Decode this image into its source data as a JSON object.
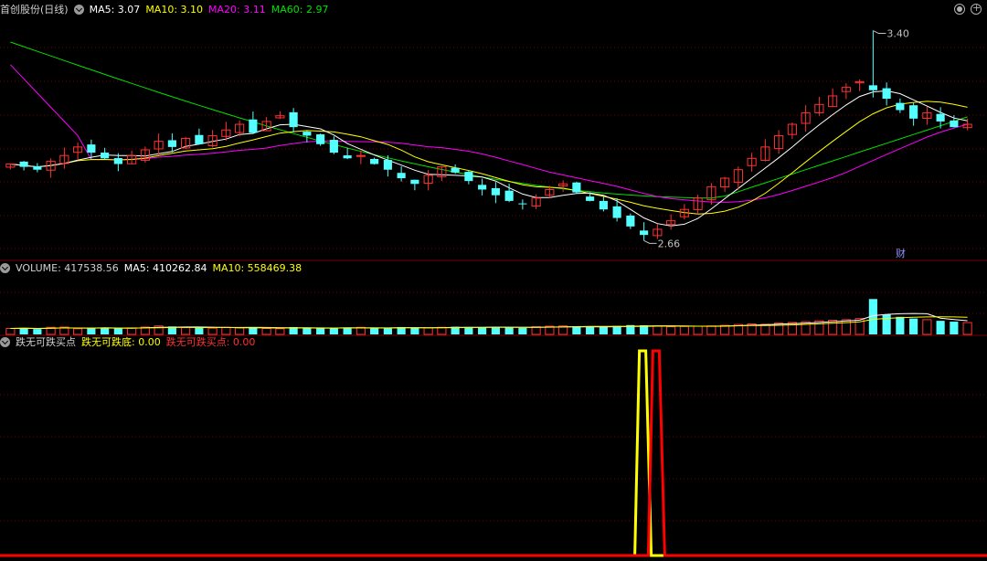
{
  "header_price": {
    "name": "首创股份(日线)",
    "ma5": "MA5: 3.07",
    "ma10": "MA10: 3.10",
    "ma20": "MA20: 3.11",
    "ma60": "MA60: 2.97"
  },
  "header_volume": {
    "name": "VOLUME: 417538.56",
    "ma5": "MA5: 410262.84",
    "ma10": "MA10: 558469.38"
  },
  "header_indicator": {
    "name": "跌无可跌买点",
    "line1": "跌无可跌底: 0.00",
    "line2": "跌无可跌买点: 0.00"
  },
  "annotations": {
    "high": "3.40",
    "low": "2.66",
    "fin_mark": "财"
  },
  "colors": {
    "up": "#ff3232",
    "down": "#54ffff",
    "ma5": "#ffffff",
    "ma10": "#ffff00",
    "ma20": "#ff00ff",
    "ma60": "#00e000",
    "grid": "#7a0000",
    "ind_yellow": "#ffff00",
    "ind_red": "#ff0000"
  },
  "chart_data": {
    "type": "candlestick",
    "price_ylim": [
      2.6,
      3.45
    ],
    "closes": [
      2.93,
      2.92,
      2.91,
      2.94,
      2.96,
      2.99,
      2.97,
      2.95,
      2.93,
      2.96,
      2.98,
      3.01,
      2.99,
      3.02,
      3.0,
      3.03,
      3.05,
      3.07,
      3.04,
      3.08,
      3.1,
      3.06,
      3.03,
      3.0,
      2.97,
      2.95,
      2.96,
      2.93,
      2.91,
      2.88,
      2.86,
      2.89,
      2.92,
      2.9,
      2.87,
      2.84,
      2.82,
      2.8,
      2.79,
      2.81,
      2.84,
      2.86,
      2.83,
      2.8,
      2.77,
      2.74,
      2.71,
      2.68,
      2.7,
      2.73,
      2.77,
      2.81,
      2.85,
      2.88,
      2.91,
      2.95,
      2.99,
      3.03,
      3.07,
      3.11,
      3.14,
      3.17,
      3.2,
      3.22,
      3.19,
      3.16,
      3.12,
      3.09,
      3.11,
      3.08,
      3.06,
      3.07
    ],
    "price_high_marker": 3.4,
    "price_low_marker": 2.66,
    "volume_ylim": [
      0,
      1900000
    ],
    "volumes": [
      210000,
      230000,
      190000,
      250000,
      260000,
      200000,
      220000,
      240000,
      210000,
      230000,
      260000,
      300000,
      280000,
      240000,
      230000,
      220000,
      250000,
      230000,
      240000,
      210000,
      200000,
      260000,
      230000,
      220000,
      210000,
      240000,
      250000,
      230000,
      220000,
      260000,
      240000,
      230000,
      250000,
      270000,
      260000,
      250000,
      260000,
      240000,
      230000,
      270000,
      290000,
      300000,
      280000,
      260000,
      270000,
      300000,
      330000,
      320000,
      290000,
      270000,
      280000,
      290000,
      300000,
      320000,
      350000,
      370000,
      360000,
      400000,
      420000,
      450000,
      480000,
      500000,
      520000,
      560000,
      1250000,
      700000,
      620000,
      560000,
      520000,
      480000,
      450000,
      417538.56
    ],
    "indicator_ylim": [
      0,
      1
    ],
    "indicator_series": [
      {
        "name": "跌无可跌底",
        "pulse_index": 47,
        "value_peak": 1.0
      },
      {
        "name": "跌无可跌买点",
        "pulse_index": 48,
        "value_peak": 1.0
      }
    ]
  }
}
